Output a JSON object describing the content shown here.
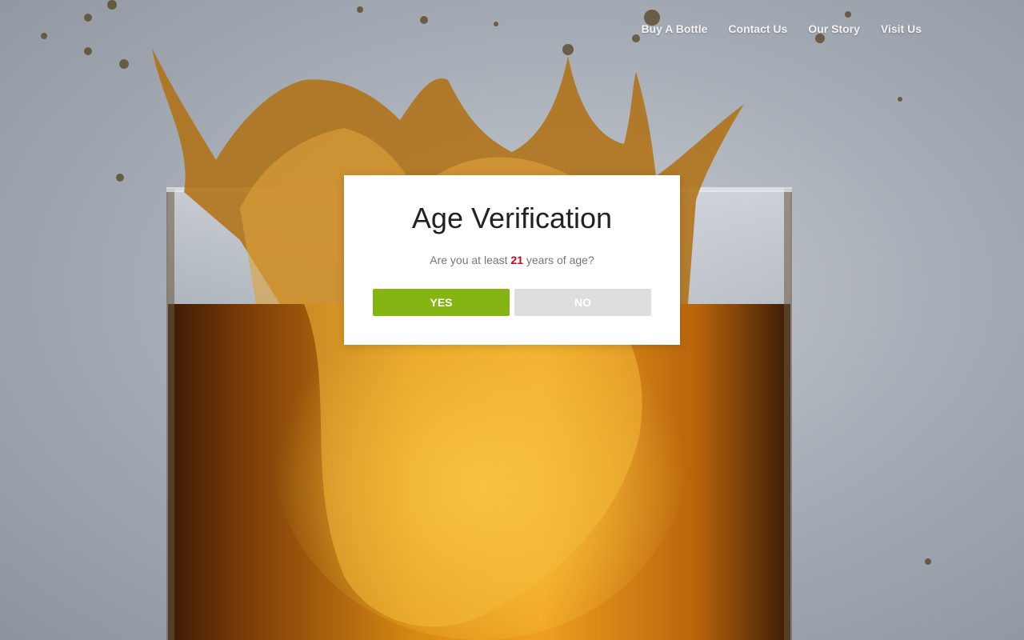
{
  "nav": {
    "items": [
      {
        "label": "Buy A Bottle"
      },
      {
        "label": "Contact Us"
      },
      {
        "label": "Our Story"
      },
      {
        "label": "Visit Us"
      }
    ]
  },
  "modal": {
    "title": "Age Verification",
    "question_prefix": "Are you at least ",
    "age": "21",
    "question_suffix": " years of age?",
    "yes_label": "YES",
    "no_label": "NO"
  },
  "colors": {
    "yes_button": "#84b513",
    "no_button": "#dedede",
    "age_highlight": "#d0021b"
  }
}
